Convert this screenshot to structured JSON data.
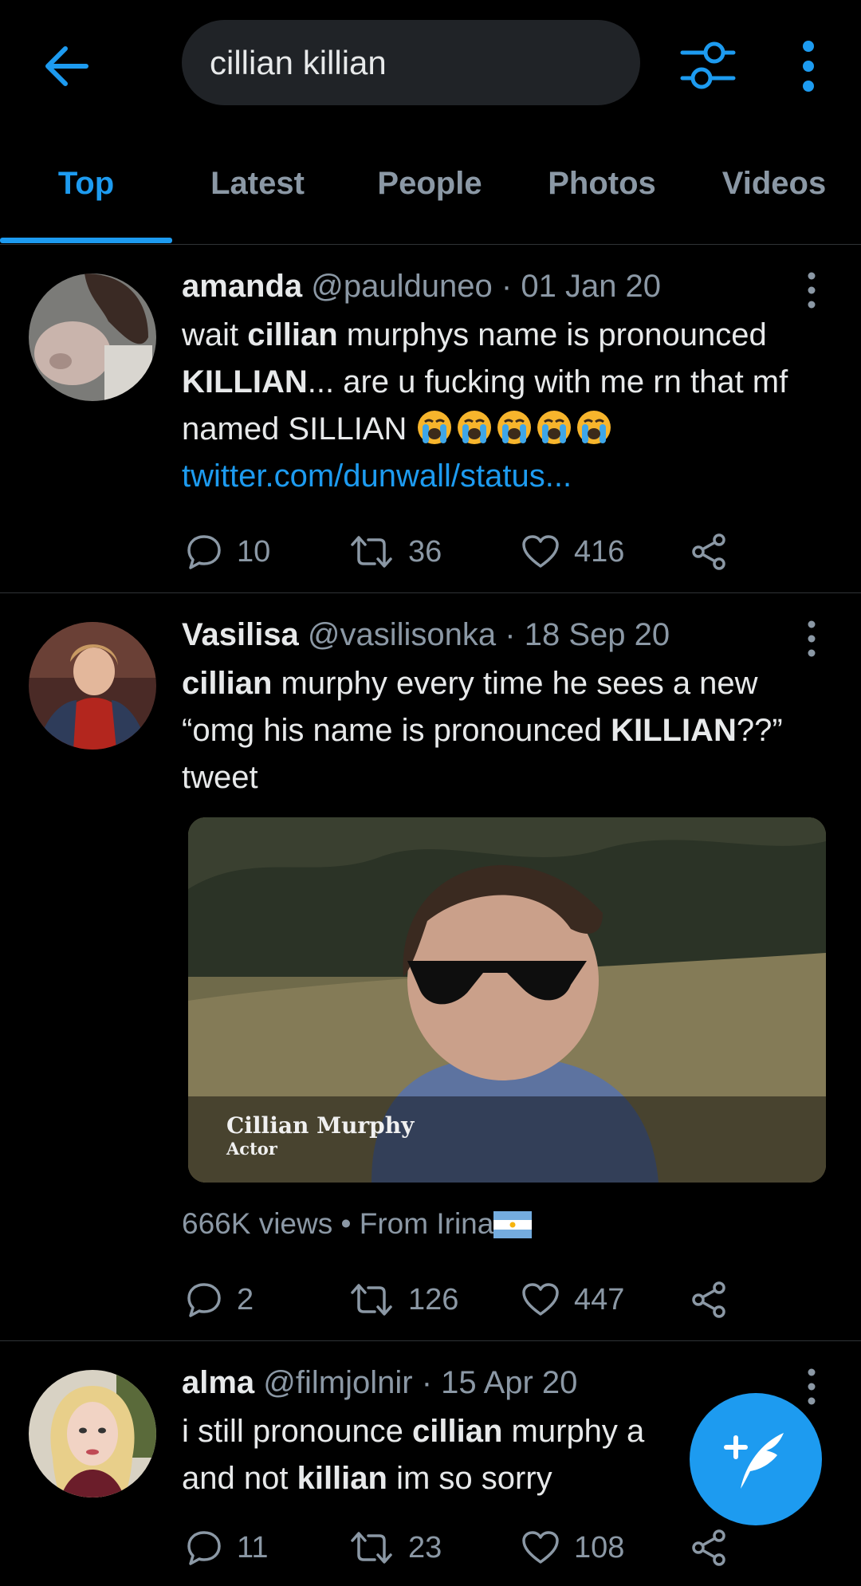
{
  "search": {
    "query": "cillian killian"
  },
  "tabs": [
    {
      "label": "Top",
      "active": true
    },
    {
      "label": "Latest",
      "active": false
    },
    {
      "label": "People",
      "active": false
    },
    {
      "label": "Photos",
      "active": false
    },
    {
      "label": "Videos",
      "active": false
    }
  ],
  "tweets": [
    {
      "name": "amanda",
      "handle": "@paulduneo",
      "sep": "·",
      "date": "01 Jan 20",
      "text": {
        "p1": "wait ",
        "b1": "cillian",
        "p2": " murphys name is pronounced ",
        "b2": "KILLIAN",
        "p3": "... are u fucking with me rn that mf named SILLIAN ",
        "link": "twitter.com/dunwall/status..."
      },
      "emoji": "loudly-crying-face",
      "replies": "10",
      "retweets": "36",
      "likes": "416"
    },
    {
      "name": "Vasilisa",
      "handle": "@vasilisonka",
      "sep": "·",
      "date": "18 Sep 20",
      "text": {
        "b1": "cillian",
        "p1": " murphy every time he sees a new “omg his name is pronounced ",
        "b2": "KILLIAN",
        "p2": "??” tweet"
      },
      "media": {
        "caption_name": "Cillian Murphy",
        "caption_role": "Actor"
      },
      "views": "666K views",
      "dot": "•",
      "source": "From Irina",
      "flag": "argentina-flag-icon",
      "replies": "2",
      "retweets": "126",
      "likes": "447"
    },
    {
      "name": "alma",
      "handle": "@filmjolnir",
      "sep": "·",
      "date": "15 Apr 20",
      "text": {
        "p1": "i still pronounce ",
        "b1": "cillian",
        "p2": " murphy a",
        "p3": "and not ",
        "b2": "killian",
        "p4": " im so sorry"
      },
      "replies": "11",
      "retweets": "23",
      "likes": "108"
    }
  ],
  "colors": {
    "accent": "#1d9bf0",
    "muted": "#8b98a5",
    "text": "#e7e9ea",
    "search_bg": "#202327"
  }
}
